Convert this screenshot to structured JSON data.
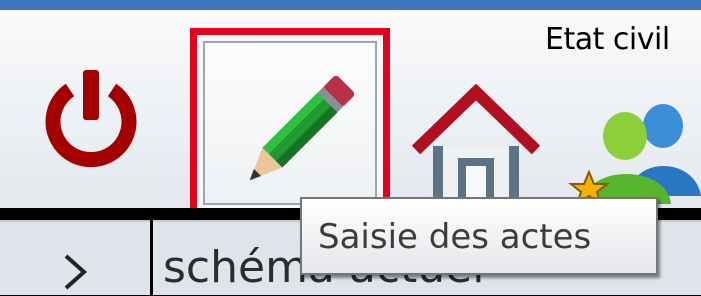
{
  "window": {
    "title_text": "Etat civil"
  },
  "toolbar": {
    "items": [
      {
        "icon": "power-icon",
        "color": "#a40000"
      },
      {
        "icon": "pencil-icon",
        "highlight": "#e8001a"
      },
      {
        "icon": "home-icon",
        "color": "#b01020"
      },
      {
        "icon": "users-icon"
      }
    ]
  },
  "tooltip": {
    "text": "Saisie des actes"
  },
  "breadcrumb": {
    "chevron": "›",
    "label": "schéma actuel"
  }
}
